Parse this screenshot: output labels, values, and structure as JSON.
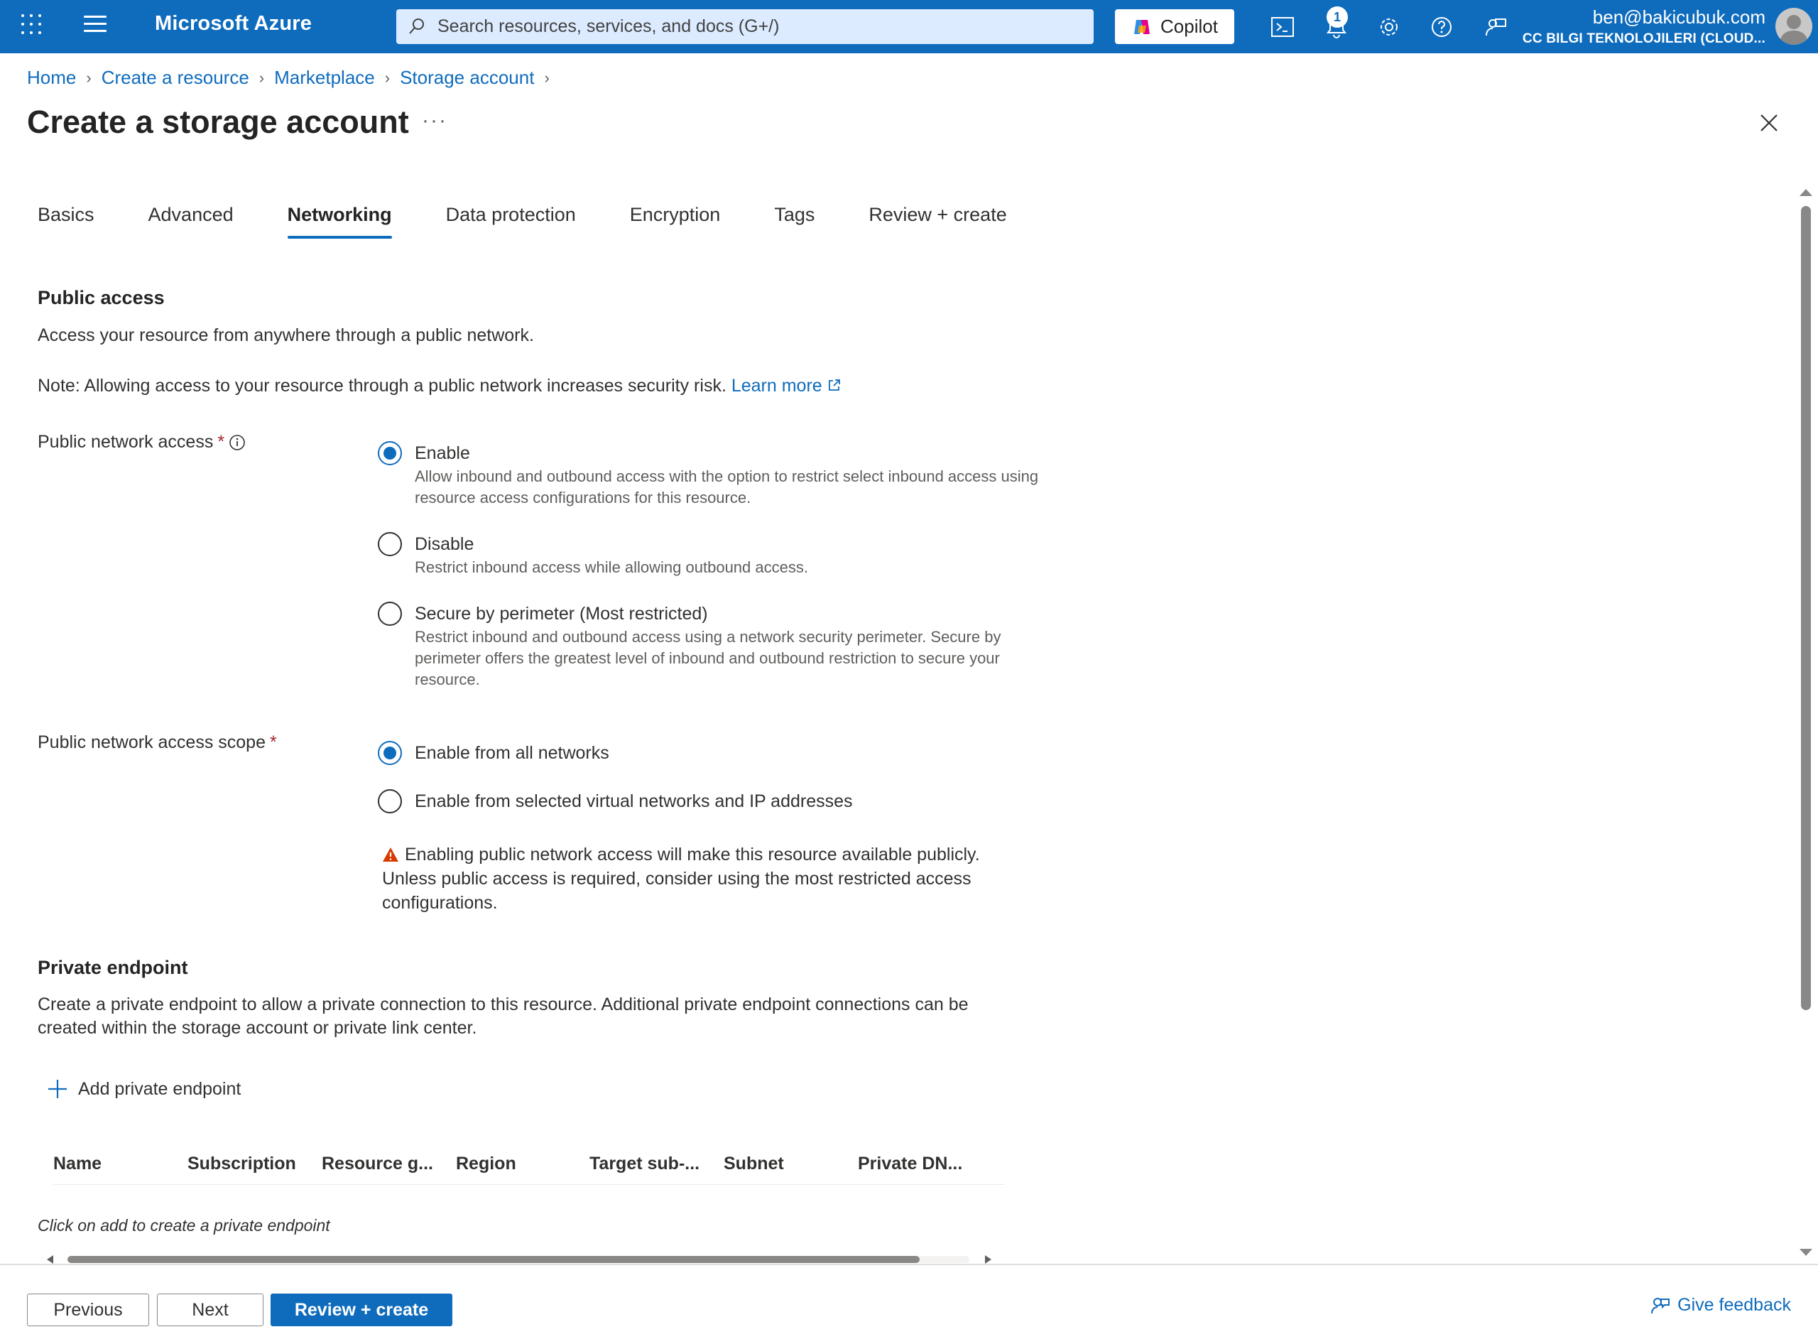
{
  "topbar": {
    "brand": "Microsoft Azure",
    "search_placeholder": "Search resources, services, and docs (G+/)",
    "copilot_label": "Copilot",
    "notification_count": "1",
    "user_email": "ben@bakicubuk.com",
    "user_tenant": "CC BILGI TEKNOLOJILERI (CLOUD..."
  },
  "breadcrumb": {
    "items": [
      "Home",
      "Create a resource",
      "Marketplace",
      "Storage account"
    ]
  },
  "page": {
    "title": "Create a storage account",
    "more_label": "···"
  },
  "tabs": [
    {
      "label": "Basics",
      "active": false
    },
    {
      "label": "Advanced",
      "active": false
    },
    {
      "label": "Networking",
      "active": true
    },
    {
      "label": "Data protection",
      "active": false
    },
    {
      "label": "Encryption",
      "active": false
    },
    {
      "label": "Tags",
      "active": false
    },
    {
      "label": "Review + create",
      "active": false
    }
  ],
  "public_access": {
    "title": "Public access",
    "description": "Access your resource from anywhere through a public network.",
    "note": "Note: Allowing access to your resource through a public network increases security risk.",
    "learn_more": "Learn more",
    "network_access": {
      "label": "Public network access",
      "required_mark": "*",
      "options": [
        {
          "label": "Enable",
          "desc": "Allow inbound and outbound access with the option to restrict select inbound access using resource access configurations for this resource.",
          "checked": true
        },
        {
          "label": "Disable",
          "desc": "Restrict inbound access while allowing outbound access.",
          "checked": false
        },
        {
          "label": "Secure by perimeter (Most restricted)",
          "desc": "Restrict inbound and outbound access using a network security perimeter. Secure by perimeter offers the greatest level of inbound and outbound restriction to secure your resource.",
          "checked": false
        }
      ]
    },
    "scope": {
      "label": "Public network access scope",
      "required_mark": "*",
      "options": [
        {
          "label": "Enable from all networks",
          "checked": true
        },
        {
          "label": "Enable from selected virtual networks and IP addresses",
          "checked": false
        }
      ]
    },
    "warning": "Enabling public network access will make this resource available publicly. Unless public access is required, consider using the most restricted access configurations."
  },
  "private_endpoint": {
    "title": "Private endpoint",
    "description": "Create a private endpoint to allow a private connection to this resource. Additional private endpoint connections can be created within the storage account or private link center.",
    "add_label": "Add private endpoint",
    "columns": [
      "Name",
      "Subscription",
      "Resource g...",
      "Region",
      "Target sub-...",
      "Subnet",
      "Private DN..."
    ],
    "empty_message": "Click on add to create a private endpoint"
  },
  "footer": {
    "previous_label": "Previous",
    "next_label": "Next",
    "review_label": "Review + create",
    "feedback_label": "Give feedback"
  },
  "colors": {
    "accent": "#0f6cbd",
    "warning": "#d83b01",
    "required": "#a4262c"
  }
}
